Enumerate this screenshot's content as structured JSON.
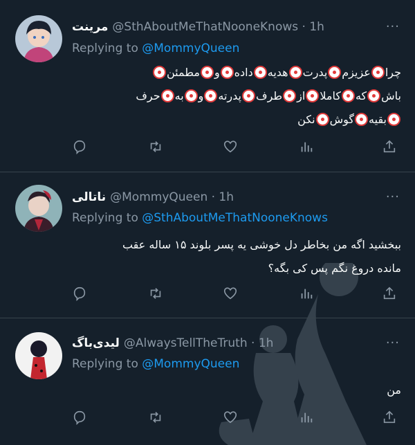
{
  "more_glyph": "···",
  "tweets": [
    {
      "name": "مرینت",
      "handle": "@SthAboutMeThatNooneKnows · 1h",
      "reply_prefix": "Replying to ",
      "reply_to": "@MommyQueen",
      "body_lines": [
        "چرا🤡عزیزم🤡پدرت🤡هدیه🤡داده🤡و🤡مطمئن🤡",
        "باش🤡که🤡کاملا🤡از🤡طرف🤡پدرته🤡و🤡به🤡حرف",
        "🤡بقیه🤡گوش🤡نکن"
      ]
    },
    {
      "name": "ناتالی",
      "handle": "@MommyQueen · 1h",
      "reply_prefix": "Replying to ",
      "reply_to": "@SthAboutMeThatNooneKnows",
      "body_lines": [
        "ببخشید اگه من بخاطر دل خوشی یه پسر بلوند ۱۵ ساله عقب",
        "مانده دروغ نگم پس کی بگه؟"
      ]
    },
    {
      "name": "لیدی‌باگ",
      "handle": "@AlwaysTellTheTruth · 1h",
      "reply_prefix": "Replying to ",
      "reply_to": "@MommyQueen",
      "body_lines": [
        "من"
      ]
    }
  ],
  "icons": {
    "reply": "reply-icon",
    "retweet": "retweet-icon",
    "like": "like-icon",
    "stats": "analytics-icon",
    "share": "share-icon"
  }
}
